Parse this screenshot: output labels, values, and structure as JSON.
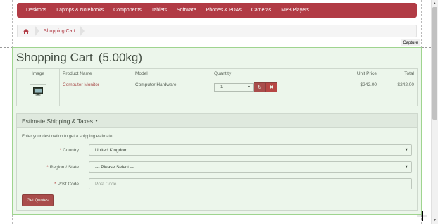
{
  "nav": {
    "items": [
      "Desktops",
      "Laptops & Notebooks",
      "Components",
      "Tablets",
      "Software",
      "Phones & PDAs",
      "Cameras",
      "MP3 Players"
    ]
  },
  "breadcrumb": {
    "home_icon": "home-icon",
    "current": "Shopping Cart"
  },
  "capture_label": "Capture",
  "page": {
    "title": "Shopping Cart",
    "weight": "(5.00kg)"
  },
  "cart": {
    "headers": [
      "Image",
      "Product Name",
      "Model",
      "Quantity",
      "Unit Price",
      "Total"
    ],
    "rows": [
      {
        "image_icon": "monitor-icon",
        "product": "Computer Monitor",
        "model": "Computer Hardware",
        "quantity": "1",
        "unit_price": "$242.00",
        "total": "$242.00"
      }
    ]
  },
  "shipping": {
    "heading": "Estimate Shipping & Taxes",
    "intro": "Enter your destination to get a shipping estimate.",
    "country_label": "Country",
    "country_value": "United Kingdom",
    "region_label": "Region / State",
    "region_value": "--- Please Select ---",
    "postcode_label": "Post Code",
    "postcode_placeholder": "Post Code",
    "button_label": "Get Quotes",
    "required_mark": "*"
  },
  "colors": {
    "brand": "#b13b45",
    "overlay": "#9fd48f"
  }
}
